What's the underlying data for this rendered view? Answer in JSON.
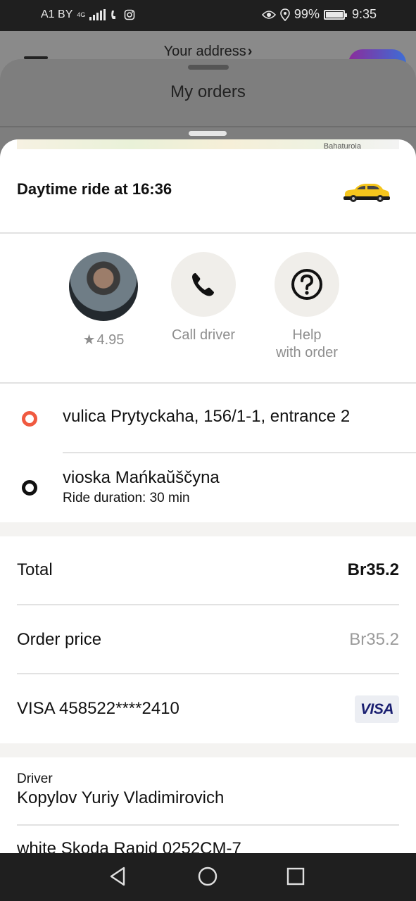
{
  "status_bar": {
    "carrier": "A1 BY",
    "network": "4G",
    "battery": "99%",
    "time": "9:35"
  },
  "background": {
    "address_label": "Your address",
    "address_chevron": "›",
    "sheet_title": "My orders",
    "map_label": "Bahaturoia"
  },
  "ride": {
    "title": "Daytime ride at 16:36",
    "car_icon": "yellow-taxi-car-icon"
  },
  "actions": {
    "driver_rating": "4.95",
    "rating_icon": "★",
    "call_label": "Call driver",
    "help_label_line1": "Help",
    "help_label_line2": "with order"
  },
  "route": {
    "pickup": "vulica Prytyckaha, 156/1-1, entrance 2",
    "destination": "vioska Mańkaŭščyna",
    "duration": "Ride duration: 30 min"
  },
  "payment": {
    "total_label": "Total",
    "total_value": "Br35.2",
    "order_price_label": "Order price",
    "order_price_value": "Br35.2",
    "card_label": "VISA 458522****2410",
    "card_brand": "VISA"
  },
  "driver": {
    "label": "Driver",
    "name": "Kopylov Yuriy Vladimirovich",
    "vehicle": "white Skoda Rapid 0252CM-7"
  },
  "colors": {
    "pickup_dot": "#f05a40",
    "destination_dot": "#111111",
    "visa_blue": "#1a1f71"
  }
}
